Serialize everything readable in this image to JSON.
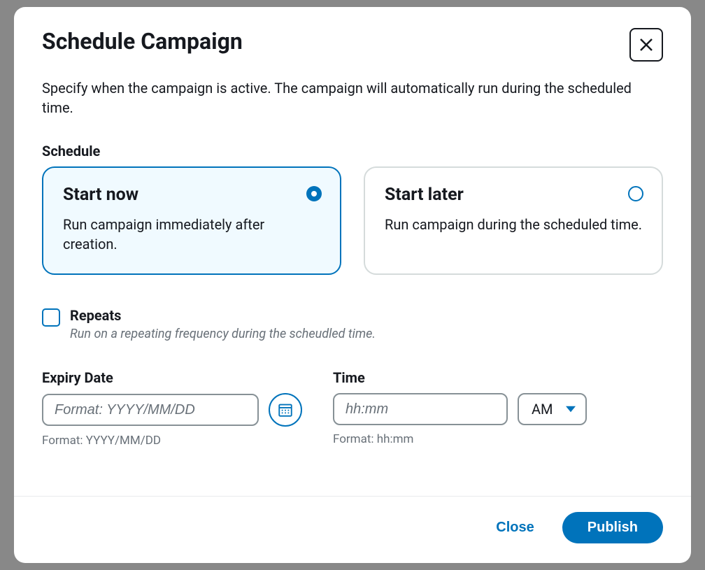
{
  "modal": {
    "title": "Schedule Campaign",
    "description": "Specify when the campaign is active. The campaign will automatically run during the scheduled time.",
    "scheduleLabel": "Schedule",
    "scheduleOptions": [
      {
        "title": "Start now",
        "desc": "Run campaign immediately after creation.",
        "selected": true
      },
      {
        "title": "Start later",
        "desc": "Run campaign during the scheduled time.",
        "selected": false
      }
    ],
    "repeats": {
      "label": "Repeats",
      "desc": "Run on a repeating frequency during the scheudled time.",
      "checked": false
    },
    "expiry": {
      "label": "Expiry Date",
      "placeholder": "Format: YYYY/MM/DD",
      "hint": "Format: YYYY/MM/DD"
    },
    "time": {
      "label": "Time",
      "placeholder": "hh:mm",
      "hint": "Format: hh:mm",
      "ampm": "AM"
    },
    "footer": {
      "close": "Close",
      "publish": "Publish"
    }
  }
}
